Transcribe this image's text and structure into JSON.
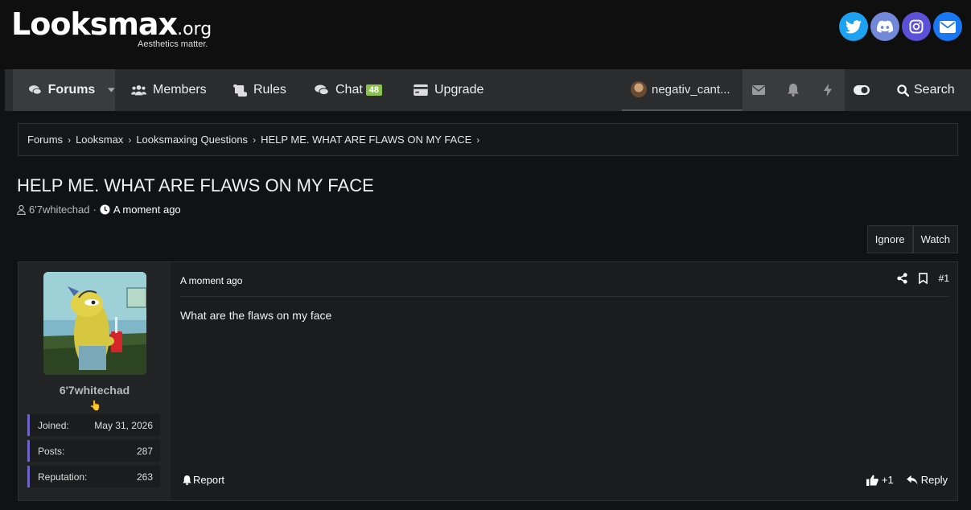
{
  "header": {
    "logo_main": "Looksmax",
    "logo_tld": ".org",
    "tagline": "Aesthetics matter.",
    "socials": [
      {
        "name": "twitter",
        "color": "#1da1f2"
      },
      {
        "name": "discord",
        "color": "#7289da"
      },
      {
        "name": "instagram",
        "color": "#5b51d8"
      },
      {
        "name": "email",
        "color": "#1877f2"
      }
    ]
  },
  "nav": {
    "forums": "Forums",
    "members": "Members",
    "rules": "Rules",
    "chat": "Chat",
    "chat_count": "48",
    "upgrade": "Upgrade",
    "username": "negativ_cant...",
    "search": "Search"
  },
  "breadcrumb": [
    "Forums",
    "Looksmax",
    "Looksmaxing Questions",
    "HELP ME. WHAT ARE FLAWS ON MY FACE"
  ],
  "thread": {
    "title": "HELP ME. WHAT ARE FLAWS ON MY FACE",
    "author": "6'7whitechad",
    "time": "A moment ago",
    "buttons": {
      "ignore": "Ignore",
      "watch": "Watch"
    }
  },
  "post": {
    "username": "6'7whitechad",
    "emoji": "👆",
    "stats": [
      {
        "label": "Joined:",
        "value": "May 31, 2026"
      },
      {
        "label": "Posts:",
        "value": "287"
      },
      {
        "label": "Reputation:",
        "value": "263"
      }
    ],
    "time": "A moment ago",
    "number": "#1",
    "body": "What are the flaws on my face",
    "report": "Report",
    "like": "+1",
    "reply": "Reply"
  }
}
